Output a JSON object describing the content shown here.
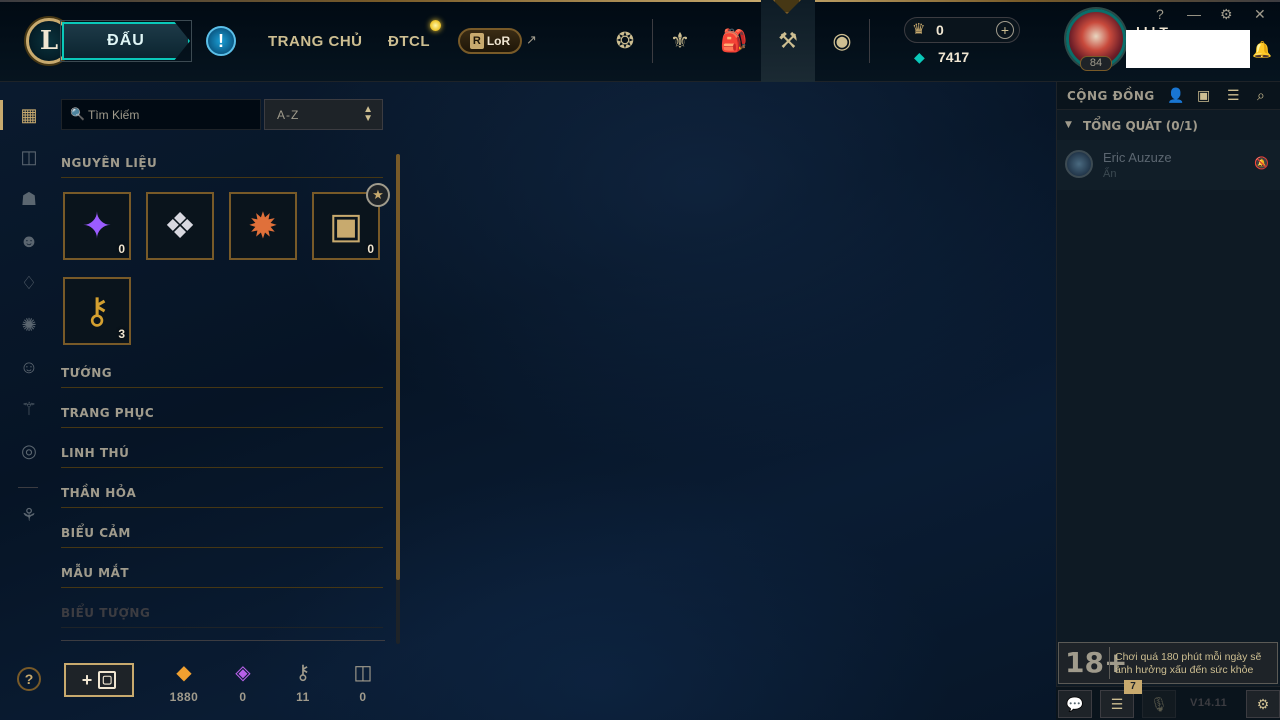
{
  "topbar": {
    "logo": "L",
    "play_label": "ĐẤU",
    "alert_icon": "!",
    "nav_links": [
      "TRANG CHỦ",
      "ĐTCL"
    ],
    "lor_label": "LoR",
    "lor_badge": "R",
    "ext_icon": "↗",
    "nav_icons": [
      {
        "name": "profile-crest-icon",
        "glyph": "❂"
      },
      {
        "name": "collection-icon",
        "glyph": "⚜"
      },
      {
        "name": "bag-icon",
        "glyph": "🎒"
      },
      {
        "name": "loot-icon",
        "glyph": "⚒"
      },
      {
        "name": "store-icon",
        "glyph": "◉"
      }
    ],
    "rp_icon": "♛",
    "rp_value": "0",
    "rp_plus": "+",
    "be_icon": "◆",
    "be_value": "7417",
    "summoner_level": "84",
    "summoner_name_peek": "l l l T",
    "window_controls": [
      "?",
      "—",
      "⚙",
      "✕"
    ],
    "bell_icon": "🔔"
  },
  "rail": {
    "items": [
      {
        "name": "rail-all-icon",
        "glyph": "▦"
      },
      {
        "name": "rail-chest-icon",
        "glyph": "◫"
      },
      {
        "name": "rail-champion-icon",
        "glyph": "☗"
      },
      {
        "name": "rail-skin-icon",
        "glyph": "☻"
      },
      {
        "name": "rail-ward-icon",
        "glyph": "♢"
      },
      {
        "name": "rail-emote-icon",
        "glyph": "✺"
      },
      {
        "name": "rail-face-icon",
        "glyph": "☺"
      },
      {
        "name": "rail-summoner-icon",
        "glyph": "⚚"
      },
      {
        "name": "rail-profile-icon",
        "glyph": "◎"
      },
      {
        "name": "rail-other-icon",
        "glyph": "⚘"
      }
    ],
    "help": "?"
  },
  "loot": {
    "search_placeholder": "Tìm Kiếm",
    "search_icon": "🔍",
    "sort_value": "A-Z",
    "sort_chevron": "▲▼",
    "categories": [
      "NGUYÊN LIỆU",
      "TƯỚNG",
      "TRANG PHỤC",
      "LINH THÚ",
      "THẦN HỎA",
      "BIỂU CẢM",
      "MẪU MẮT",
      "BIỂU TƯỢNG"
    ],
    "materials": [
      {
        "name": "essence-tile",
        "glyph": "✦",
        "color": "#9b5cff",
        "count": "0"
      },
      {
        "name": "orb-tile",
        "glyph": "❖",
        "color": "#d8d8e0",
        "count": ""
      },
      {
        "name": "event-token-tile",
        "glyph": "✹",
        "color": "#e0703a",
        "count": ""
      },
      {
        "name": "masterwork-chest-tile",
        "glyph": "▣",
        "color": "#c8aa6e",
        "count": "0"
      },
      {
        "name": "key-tile",
        "glyph": "⚷",
        "color": "#d4a030",
        "count": "3"
      }
    ],
    "star_badge": "★",
    "craft_plus": "+",
    "craft_chest": "▢",
    "currencies": [
      {
        "name": "orange-essence",
        "glyph": "◆",
        "color": "#f0a030",
        "value": "1880"
      },
      {
        "name": "mythic-essence",
        "glyph": "◈",
        "color": "#b860e8",
        "value": "0"
      },
      {
        "name": "key-fragment",
        "glyph": "⚷",
        "color": "#a09b8c",
        "value": "11"
      },
      {
        "name": "chest",
        "glyph": "◫",
        "color": "#a09b8c",
        "value": "0"
      }
    ]
  },
  "social": {
    "title": "CỘNG ĐỒNG",
    "icons": [
      {
        "name": "add-friend-icon",
        "glyph": "👤"
      },
      {
        "name": "add-folder-icon",
        "glyph": "▣"
      },
      {
        "name": "list-icon",
        "glyph": "☰"
      },
      {
        "name": "search-icon",
        "glyph": "⌕"
      }
    ],
    "group_arrow": "▼",
    "group_label": "TỔNG QUÁT (0/1)",
    "friend_name": "Eric Auzuze",
    "friend_status": "Ẩn",
    "mute_icon": "🔕",
    "age_rating": "18+",
    "age_warning": "Chơi quá 180 phút mỗi ngày sẽ ảnh hưởng xấu đến sức khỏe",
    "chat_icon": "💬",
    "missions_icon": "☰",
    "missions_badge": "7",
    "mic_icon": "🎙",
    "version": "V14.11",
    "bug_icon": "⚙"
  }
}
